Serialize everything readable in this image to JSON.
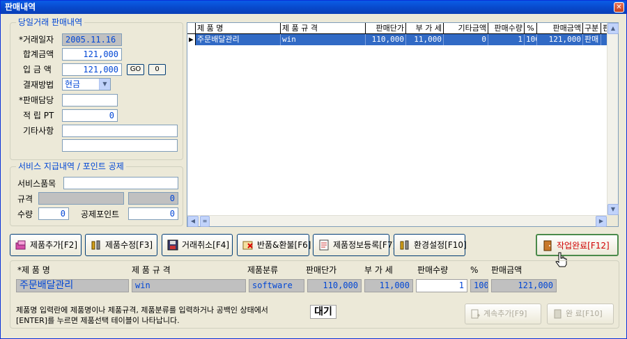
{
  "window": {
    "title": "판매내역",
    "close_glyph": "✕"
  },
  "today_group": {
    "legend": "당일거래 판매내역",
    "date_label": "*거래일자",
    "date_value": "2005.11.16",
    "total_label": "합계금액",
    "total_value": "121,000",
    "paid_label": "입 금 액",
    "paid_value": "121,000",
    "go_label": "GO",
    "zero_label": "0",
    "payment_label": "결재방법",
    "payment_value": "현금",
    "sales_person_label": "*판매담당",
    "sales_person_value": "",
    "points_label": "적 립 PT",
    "points_value": "0",
    "notes_label": "기타사항",
    "notes_line1": "",
    "notes_line2": ""
  },
  "service_group": {
    "legend": "서비스 지급내역 / 포인트 공제",
    "item_label": "서비스품목",
    "item_value": "",
    "spec_label": "규격",
    "spec_value": "",
    "spec_amount": "0",
    "qty_label": "수량",
    "qty_value": "0",
    "deduct_label": "공제포인트",
    "deduct_value": "0"
  },
  "grid": {
    "columns": [
      "제 품 명",
      "제 품 규 격",
      "판매단가",
      "부 가 세",
      "기타금액",
      "판매수량",
      "%",
      "판매금액",
      "구분",
      "판"
    ],
    "rows": [
      [
        "주문배달관리",
        "win",
        "110,000",
        "11,000",
        "0",
        "1",
        "100",
        "121,000",
        "판매",
        ""
      ]
    ]
  },
  "toolbar": {
    "add": "제품추가[F2]",
    "edit": "제품수정[F3]",
    "cancel": "거래취소[F4]",
    "return": "반품&환불[F6]",
    "register": "제품정보등록[F7]",
    "settings": "환경설정[F10]",
    "complete": "작업완료[F12]"
  },
  "entry": {
    "headers": [
      "*제 품 명",
      "제 품 규 격",
      "제품분류",
      "판매단가",
      "부 가 세",
      "판매수량",
      "%",
      "판매금액"
    ],
    "values": [
      "주문배달관리",
      "win",
      "software",
      "110,000",
      "11,000",
      "1",
      "100",
      "121,000"
    ],
    "help_line1": "제품명 입력란에 제품명이나 제품규격, 제품분류를 입력하거나 공백인 상태에서",
    "help_line2": "[ENTER]를 누르면 제품선택 테이블이 나타납니다.",
    "status": "대기",
    "continue_add": "계속추가[F9]",
    "finish": "완 료[F10]"
  },
  "colors": {
    "accent": "#0046d5",
    "selection": "#316ac5",
    "titlebar": "#0847c8"
  }
}
